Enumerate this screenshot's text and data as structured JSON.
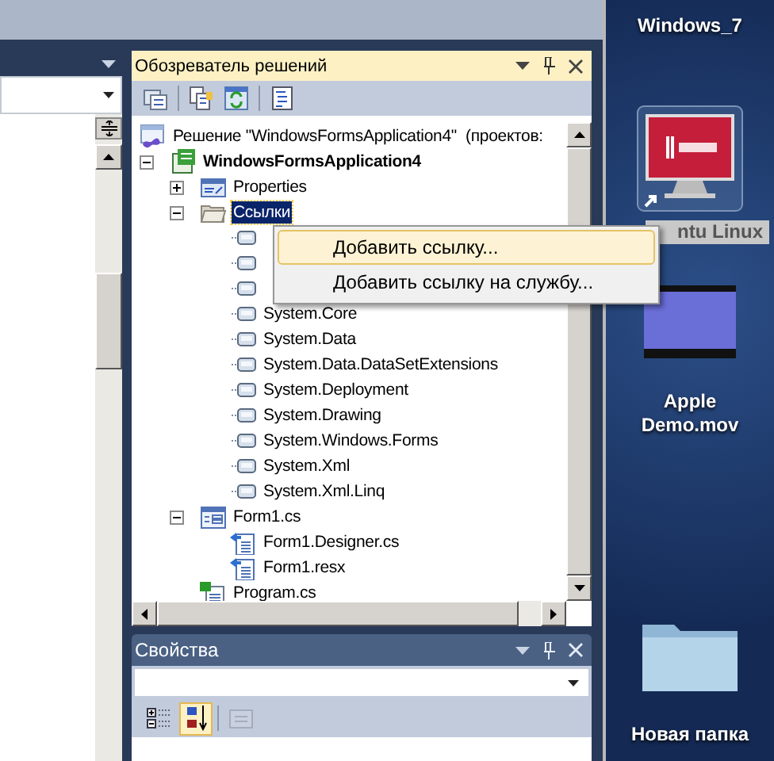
{
  "solution_explorer": {
    "title": "Обозреватель решений",
    "tree": [
      {
        "label": "Решение \"WindowsFormsApplication4\"  (проектов:",
        "kind": "solution",
        "selected": false,
        "children": [
          {
            "label": "WindowsFormsApplication4",
            "kind": "project",
            "expanded": true,
            "selected": false,
            "children": [
              {
                "label": "Properties",
                "kind": "properties",
                "expanded": false,
                "selected": false
              },
              {
                "label": "Ссылки",
                "kind": "folder",
                "expanded": true,
                "selected": true,
                "children": [
                  {
                    "kind": "reference",
                    "selected": false
                  },
                  {
                    "kind": "reference",
                    "selected": false
                  },
                  {
                    "kind": "reference",
                    "selected": false
                  },
                  {
                    "label": "System.Core",
                    "kind": "reference",
                    "selected": false
                  },
                  {
                    "label": "System.Data",
                    "kind": "reference",
                    "selected": false
                  },
                  {
                    "label": "System.Data.DataSetExtensions",
                    "kind": "reference",
                    "selected": false
                  },
                  {
                    "label": "System.Deployment",
                    "kind": "reference",
                    "selected": false
                  },
                  {
                    "label": "System.Drawing",
                    "kind": "reference",
                    "selected": false
                  },
                  {
                    "label": "System.Windows.Forms",
                    "kind": "reference",
                    "selected": false
                  },
                  {
                    "label": "System.Xml",
                    "kind": "reference",
                    "selected": false
                  },
                  {
                    "label": "System.Xml.Linq",
                    "kind": "reference",
                    "selected": false
                  }
                ]
              },
              {
                "label": "Form1.cs",
                "kind": "form",
                "expanded": true,
                "selected": false,
                "children": [
                  {
                    "label": "Form1.Designer.cs",
                    "kind": "designer",
                    "selected": false
                  },
                  {
                    "label": "Form1.resx",
                    "kind": "designer",
                    "selected": false
                  }
                ]
              },
              {
                "label": "Program.cs",
                "kind": "csfile",
                "selected": false
              }
            ]
          }
        ]
      }
    ]
  },
  "context_menu": {
    "items": [
      {
        "label": "Добавить ссылку...",
        "selected": true
      },
      {
        "label": "Добавить ссылку на службу...",
        "selected": false
      }
    ]
  },
  "properties": {
    "title": "Свойства",
    "toolbar": [
      {
        "kind": "categorized",
        "selected": false,
        "disabled": false
      },
      {
        "kind": "alphabetical",
        "selected": true,
        "disabled": false
      },
      {
        "kind": "pages",
        "selected": false,
        "disabled": true
      }
    ]
  },
  "desktop": {
    "icons": [
      {
        "label": "Windows_7",
        "kind": "partial"
      },
      {
        "label": "ntu Linux",
        "kind": "app"
      },
      {
        "label": "Apple Demo.mov",
        "kind": "video"
      },
      {
        "label": "Новая папка",
        "kind": "folder"
      }
    ]
  }
}
